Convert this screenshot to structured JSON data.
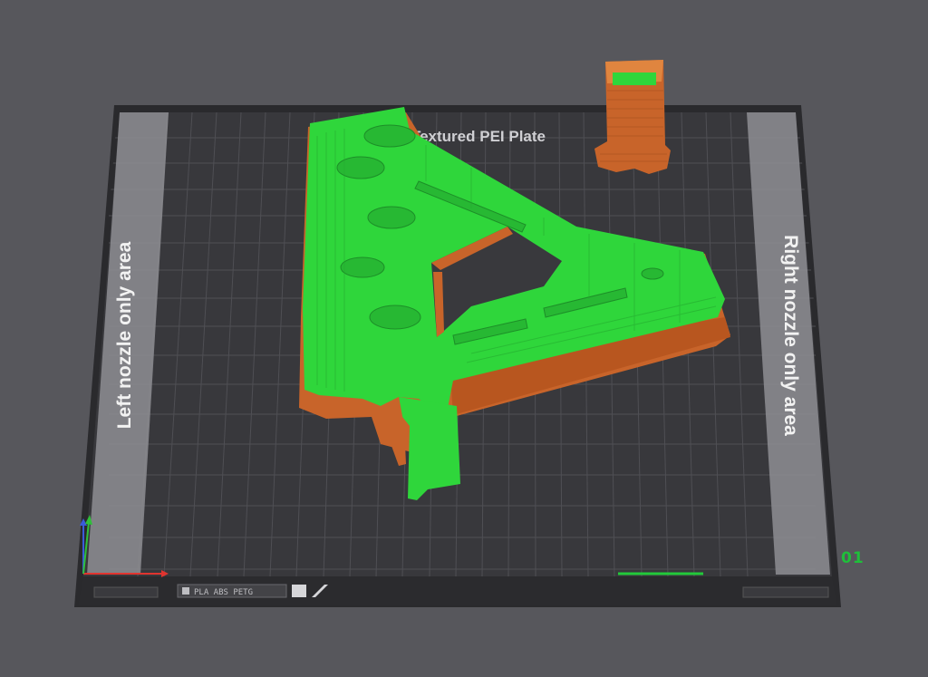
{
  "viewport": {
    "plate_title": "Textured PEI Plate",
    "left_zone_label": "Left nozzle only area",
    "right_zone_label": "Right nozzle only area",
    "filament_tag": "PLA ABS PETG",
    "plate_index": "01"
  },
  "colors": {
    "background": "#57575c",
    "plate": "#39393d",
    "grid_line": "#4d4d52",
    "zone": "#8d8d92",
    "frame": "#2a2a2d",
    "filament_green": "#2fd63b",
    "filament_orange": "#d9702b",
    "axis_x": "#e0342f",
    "axis_y": "#2fbf3a",
    "axis_z": "#3a5ad9",
    "active_plate_bar": "#22c93a"
  },
  "icons": {
    "axes": "xyz-axes-icon",
    "logo": "printer-brand-icon"
  }
}
